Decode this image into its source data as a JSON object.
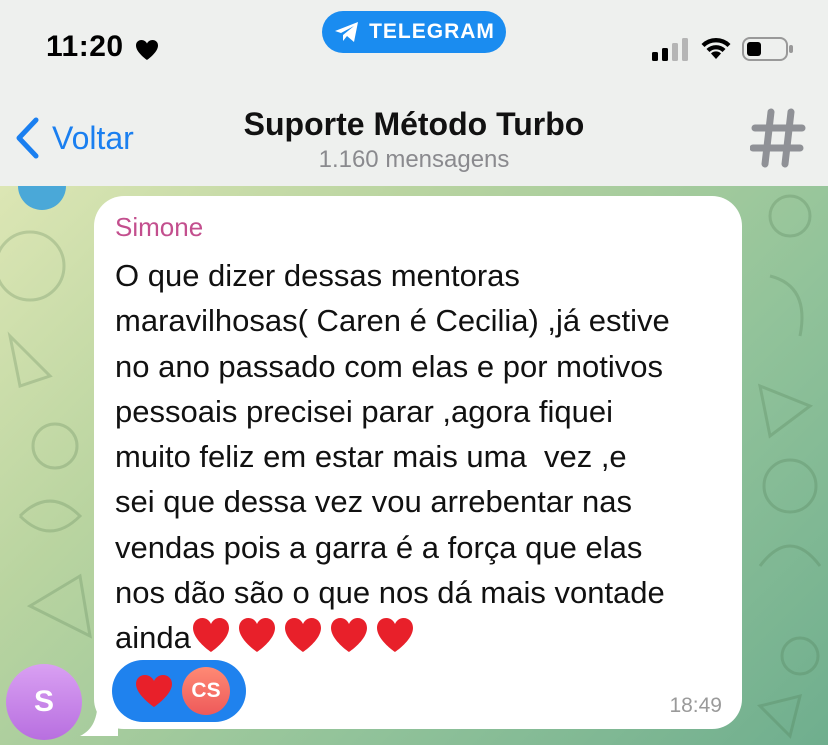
{
  "status_bar": {
    "time": "11:20",
    "app_pill_label": "TELEGRAM"
  },
  "header": {
    "back_label": "Voltar",
    "title": "Suporte Método Turbo",
    "subtitle": "1.160 mensagens"
  },
  "message": {
    "sender": "Simone",
    "avatar_initial": "S",
    "text": "O que dizer dessas mentoras\nmaravilhosas( Caren é Cecilia) ,já estive\nno ano passado com elas e por motivos\npessoais precisei parar ,agora fiquei\nmuito feliz em estar mais uma  vez ,e\nsei que dessa vez vou arrebentar nas\nvendas pois a garra é a força que elas\nnos dão são o que nos dá mais vontade\nainda",
    "trailing_emoji": "heart-emoji",
    "trailing_emoji_count": 5,
    "reaction": {
      "emoji": "heart-emoji",
      "reactor_initials": "CS"
    },
    "time": "18:49"
  },
  "colors": {
    "accent": "#1a7ff0",
    "sender_name": "#c34f8e",
    "reaction_pill": "#1f82ee",
    "heart": "#e8202a"
  }
}
